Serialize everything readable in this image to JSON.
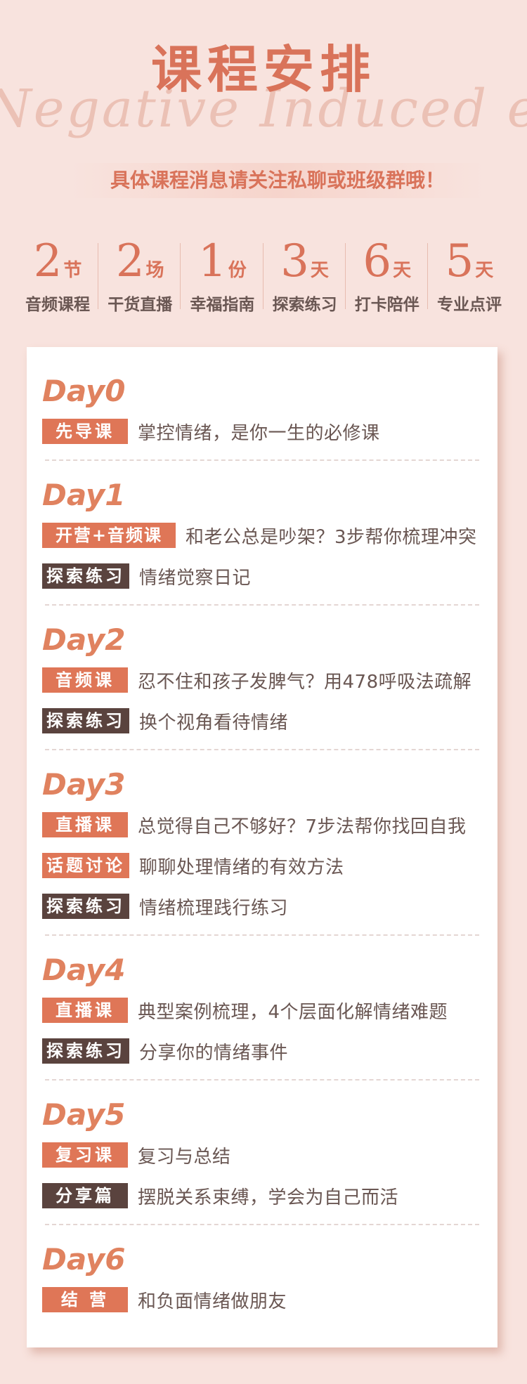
{
  "header": {
    "title": "课程安排",
    "script_text": "Negative Induced emotion",
    "subtitle": "具体课程消息请关注私聊或班级群哦！"
  },
  "stats": [
    {
      "num": "2",
      "unit": "节",
      "label": "音频课程"
    },
    {
      "num": "2",
      "unit": "场",
      "label": "干货直播"
    },
    {
      "num": "1",
      "unit": "份",
      "label": "幸福指南"
    },
    {
      "num": "3",
      "unit": "天",
      "label": "探索练习"
    },
    {
      "num": "6",
      "unit": "天",
      "label": "打卡陪伴"
    },
    {
      "num": "5",
      "unit": "天",
      "label": "专业点评"
    }
  ],
  "days": [
    {
      "title": "Day0",
      "rows": [
        {
          "tag": "先导课",
          "text": "掌控情绪，是你一生的必修课"
        }
      ]
    },
    {
      "title": "Day1",
      "rows": [
        {
          "tag": "开营+音频课",
          "text": "和老公总是吵架？3步帮你梳理冲突"
        },
        {
          "tag": "探索练习",
          "text": "情绪觉察日记"
        }
      ]
    },
    {
      "title": "Day2",
      "rows": [
        {
          "tag": "音频课",
          "text": "忍不住和孩子发脾气？用478呼吸法疏解"
        },
        {
          "tag": "探索练习",
          "text": "换个视角看待情绪"
        }
      ]
    },
    {
      "title": "Day3",
      "rows": [
        {
          "tag": "直播课",
          "text": "总觉得自己不够好？7步法帮你找回自我"
        },
        {
          "tag": "话题讨论",
          "text": "聊聊处理情绪的有效方法"
        },
        {
          "tag": "探索练习",
          "text": "情绪梳理践行练习"
        }
      ]
    },
    {
      "title": "Day4",
      "rows": [
        {
          "tag": "直播课",
          "text": "典型案例梳理，4个层面化解情绪难题"
        },
        {
          "tag": "探索练习",
          "text": "分享你的情绪事件"
        }
      ]
    },
    {
      "title": "Day5",
      "rows": [
        {
          "tag": "复习课",
          "text": "复习与总结"
        },
        {
          "tag": "分享篇",
          "text": "摆脱关系束缚，学会为自己而活"
        }
      ]
    },
    {
      "title": "Day6",
      "rows": [
        {
          "tag": "结 营",
          "text": "和负面情绪做朋友"
        }
      ]
    }
  ],
  "colors": {
    "accent": "#df7657",
    "dark_tag": "#5a433e",
    "background": "#f8e3de"
  }
}
